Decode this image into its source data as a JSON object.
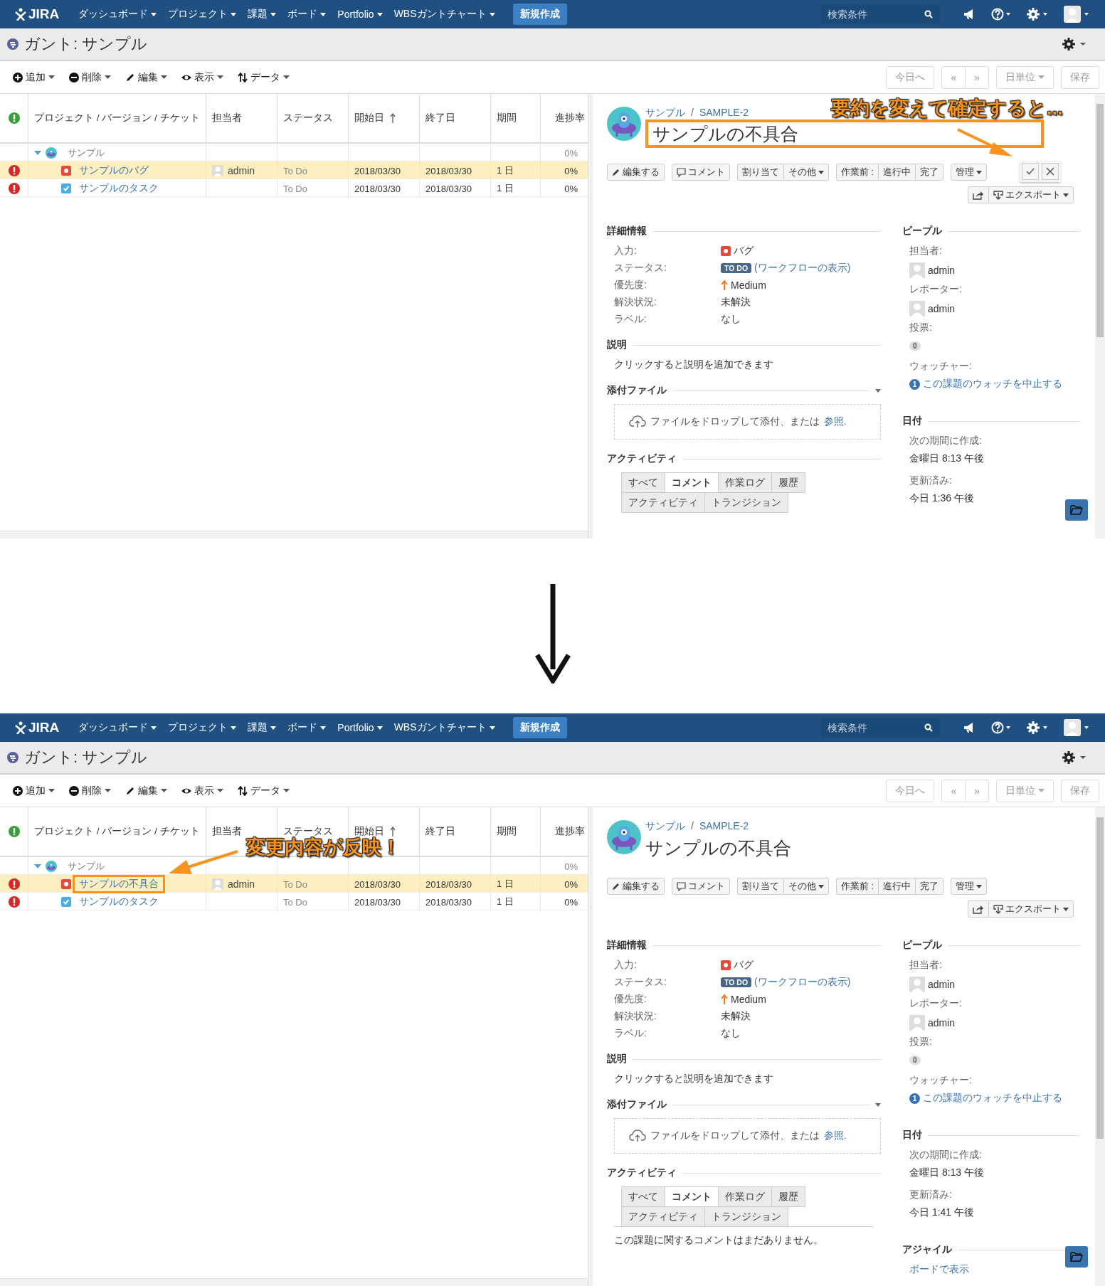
{
  "screens": [
    {
      "nav": {
        "logo": "JIRA",
        "menus": [
          "ダッシュボード",
          "プロジェクト",
          "課題",
          "ボード",
          "Portfolio",
          "WBSガントチャート"
        ],
        "create": "新規作成",
        "search_placeholder": "検索条件"
      },
      "title": "ガント: サンプル",
      "toolbar": [
        {
          "kind": "add",
          "label": "追加"
        },
        {
          "kind": "remove",
          "label": "削除"
        },
        {
          "kind": "edit",
          "label": "編集"
        },
        {
          "kind": "view",
          "label": "表示"
        },
        {
          "kind": "data",
          "label": "データ"
        }
      ],
      "view_buttons": {
        "today": "今日へ",
        "prev": "«",
        "next": "»",
        "unit": "日単位",
        "save": "保存"
      },
      "columns": [
        {
          "label": "プロジェクト / バージョン / チケット",
          "sorted": false
        },
        {
          "label": "担当者",
          "sorted": false
        },
        {
          "label": "ステータス",
          "sorted": false
        },
        {
          "label": "開始日",
          "sorted": true
        },
        {
          "label": "終了日",
          "sorted": false
        },
        {
          "label": "期間",
          "sorted": false
        },
        {
          "label": "進捗率",
          "sorted": false
        }
      ],
      "rows": [
        {
          "kind": "project",
          "name": "サンプル",
          "expanded": true,
          "selected": false,
          "highlighted": false,
          "progress": "0%"
        },
        {
          "kind": "bug",
          "name": "サンプルのバグ",
          "selected": true,
          "highlighted": false,
          "assignee": "admin",
          "status": "To Do",
          "start": "2018/03/30",
          "end": "2018/03/30",
          "duration": "1 日",
          "progress": "0%"
        },
        {
          "kind": "task",
          "name": "サンプルのタスク",
          "selected": false,
          "highlighted": false,
          "status": "To Do",
          "start": "2018/03/30",
          "end": "2018/03/30",
          "duration": "1 日",
          "progress": "0%"
        }
      ],
      "issue": {
        "project": "サンプル",
        "separator": "/",
        "key": "SAMPLE-2",
        "summary": "サンプルの不具合",
        "editing": true,
        "highlighted": true,
        "actions": [
          [
            {
              "kind": "edit",
              "label": "編集する"
            }
          ],
          [
            {
              "kind": "comment",
              "label": "コメント"
            }
          ],
          [
            {
              "kind": "plain",
              "label": "割り当て"
            },
            {
              "kind": "menu",
              "label": "その他"
            }
          ],
          [
            {
              "kind": "plain",
              "label": "作業前 :"
            },
            {
              "kind": "plain",
              "label": "進行中"
            },
            {
              "kind": "plain",
              "label": "完了"
            }
          ],
          [
            {
              "kind": "menu",
              "label": "管理"
            }
          ]
        ],
        "export": "エクスポート",
        "details": {
          "title": "詳細情報",
          "fields": [
            {
              "kind": "type",
              "label": "入力:",
              "value": "バグ"
            },
            {
              "kind": "status",
              "label": "ステータス:",
              "value": "TO DO",
              "link": "(ワークフローの表示)"
            },
            {
              "kind": "priority",
              "label": "優先度:",
              "value": "Medium"
            },
            {
              "kind": "text",
              "label": "解決状況:",
              "value": "未解決"
            },
            {
              "kind": "text",
              "label": "ラベル:",
              "value": "なし"
            }
          ]
        },
        "description": {
          "title": "説明",
          "text": "クリックすると説明を追加できます"
        },
        "attachments": {
          "title": "添付ファイル",
          "drop": "ファイルをドロップして添付、または",
          "browse": "参照."
        },
        "activity": {
          "title": "アクティビティ",
          "tabs": [
            {
              "label": "すべて",
              "selected": false
            },
            {
              "label": "コメント",
              "selected": true
            },
            {
              "label": "作業ログ",
              "selected": false
            },
            {
              "label": "履歴",
              "selected": false
            },
            {
              "label": "アクティビティ",
              "selected": false
            },
            {
              "label": "トランジション",
              "selected": false
            }
          ]
        },
        "people": {
          "title": "ピープル",
          "assignee_label": "担当者:",
          "assignee": "admin",
          "reporter_label": "レポーター:",
          "reporter": "admin",
          "votes_label": "投票:",
          "votes": "0",
          "watchers_label": "ウォッチャー:",
          "watch_count": "1",
          "watch_link": "この課題のウォッチを中止する"
        },
        "dates": {
          "title": "日付",
          "created_label": "次の期間に作成:",
          "created": "金曜日 8:13 午後",
          "updated_label": "更新済み:",
          "updated": "今日 1:36 午後"
        }
      },
      "callout": {
        "kind": "panel",
        "text": "要約を変えて確定すると..."
      }
    },
    {
      "nav": {
        "logo": "JIRA",
        "menus": [
          "ダッシュボード",
          "プロジェクト",
          "課題",
          "ボード",
          "Portfolio",
          "WBSガントチャート"
        ],
        "create": "新規作成",
        "search_placeholder": "検索条件"
      },
      "title": "ガント: サンプル",
      "toolbar": [
        {
          "kind": "add",
          "label": "追加"
        },
        {
          "kind": "remove",
          "label": "削除"
        },
        {
          "kind": "edit",
          "label": "編集"
        },
        {
          "kind": "view",
          "label": "表示"
        },
        {
          "kind": "data",
          "label": "データ"
        }
      ],
      "view_buttons": {
        "today": "今日へ",
        "prev": "«",
        "next": "»",
        "unit": "日単位",
        "save": "保存"
      },
      "columns": [
        {
          "label": "プロジェクト / バージョン / チケット",
          "sorted": false
        },
        {
          "label": "担当者",
          "sorted": false
        },
        {
          "label": "ステータス",
          "sorted": false
        },
        {
          "label": "開始日",
          "sorted": true
        },
        {
          "label": "終了日",
          "sorted": false
        },
        {
          "label": "期間",
          "sorted": false
        },
        {
          "label": "進捗率",
          "sorted": false
        }
      ],
      "rows": [
        {
          "kind": "project",
          "name": "サンプル",
          "expanded": true,
          "selected": false,
          "highlighted": false,
          "progress": "0%"
        },
        {
          "kind": "bug",
          "name": "サンプルの不具合",
          "selected": true,
          "highlighted": true,
          "assignee": "admin",
          "status": "To Do",
          "start": "2018/03/30",
          "end": "2018/03/30",
          "duration": "1 日",
          "progress": "0%"
        },
        {
          "kind": "task",
          "name": "サンプルのタスク",
          "selected": false,
          "highlighted": false,
          "status": "To Do",
          "start": "2018/03/30",
          "end": "2018/03/30",
          "duration": "1 日",
          "progress": "0%"
        }
      ],
      "issue": {
        "project": "サンプル",
        "separator": "/",
        "key": "SAMPLE-2",
        "summary": "サンプルの不具合",
        "editing": false,
        "highlighted": false,
        "actions": [
          [
            {
              "kind": "edit",
              "label": "編集する"
            }
          ],
          [
            {
              "kind": "comment",
              "label": "コメント"
            }
          ],
          [
            {
              "kind": "plain",
              "label": "割り当て"
            },
            {
              "kind": "menu",
              "label": "その他"
            }
          ],
          [
            {
              "kind": "plain",
              "label": "作業前 :"
            },
            {
              "kind": "plain",
              "label": "進行中"
            },
            {
              "kind": "plain",
              "label": "完了"
            }
          ],
          [
            {
              "kind": "menu",
              "label": "管理"
            }
          ]
        ],
        "export": "エクスポート",
        "details": {
          "title": "詳細情報",
          "fields": [
            {
              "kind": "type",
              "label": "入力:",
              "value": "バグ"
            },
            {
              "kind": "status",
              "label": "ステータス:",
              "value": "TO DO",
              "link": "(ワークフローの表示)"
            },
            {
              "kind": "priority",
              "label": "優先度:",
              "value": "Medium"
            },
            {
              "kind": "text",
              "label": "解決状況:",
              "value": "未解決"
            },
            {
              "kind": "text",
              "label": "ラベル:",
              "value": "なし"
            }
          ]
        },
        "description": {
          "title": "説明",
          "text": "クリックすると説明を追加できます"
        },
        "attachments": {
          "title": "添付ファイル",
          "drop": "ファイルをドロップして添付、または",
          "browse": "参照."
        },
        "activity": {
          "title": "アクティビティ",
          "tabs": [
            {
              "label": "すべて",
              "selected": false
            },
            {
              "label": "コメント",
              "selected": true
            },
            {
              "label": "作業ログ",
              "selected": false
            },
            {
              "label": "履歴",
              "selected": false
            },
            {
              "label": "アクティビティ",
              "selected": false
            },
            {
              "label": "トランジション",
              "selected": false
            }
          ],
          "empty": "この課題に関するコメントはまだありません。"
        },
        "people": {
          "title": "ピープル",
          "assignee_label": "担当者:",
          "assignee": "admin",
          "reporter_label": "レポーター:",
          "reporter": "admin",
          "votes_label": "投票:",
          "votes": "0",
          "watchers_label": "ウォッチャー:",
          "watch_count": "1",
          "watch_link": "この課題のウォッチを中止する"
        },
        "dates": {
          "title": "日付",
          "created_label": "次の期間に作成:",
          "created": "金曜日 8:13 午後",
          "updated_label": "更新済み:",
          "updated": "今日 1:41 午後"
        },
        "agile": {
          "title": "アジャイル",
          "link": "ボードで表示"
        }
      },
      "callout": {
        "kind": "grid",
        "text": "変更内容が反映！"
      }
    }
  ]
}
